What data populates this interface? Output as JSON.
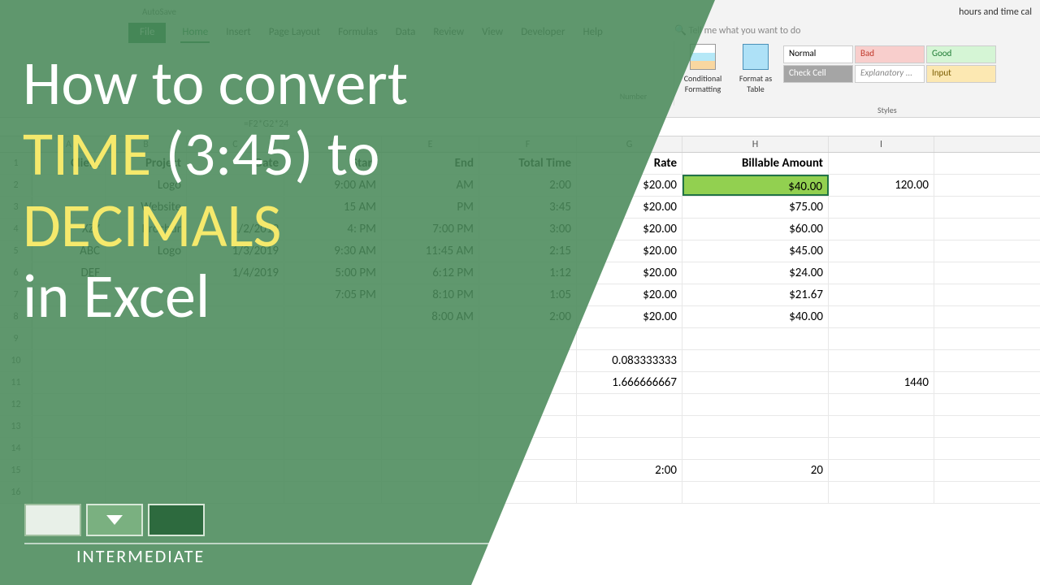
{
  "title": {
    "l1": "How to convert",
    "accent1": "TIME",
    "mid": " (3:45) to",
    "accent2": "DECIMALS",
    "l4": "in Excel"
  },
  "level": "INTERMEDIATE",
  "autosave": "AutoSave",
  "doc_title": "hours and time cal",
  "tellme": "Tell me what you want to do",
  "tabs": [
    "File",
    "Home",
    "Insert",
    "Page Layout",
    "Formulas",
    "Data",
    "Review",
    "View",
    "Developer",
    "Help"
  ],
  "ribbon": {
    "number": "Number",
    "cond": "Conditional Formatting",
    "fmt": "Format as Table",
    "styles_label": "Styles",
    "styles": [
      "Normal",
      "Bad",
      "Good",
      "Check Cell",
      "Explanatory ...",
      "Input"
    ]
  },
  "formula": "=F2*G2*24",
  "cols": [
    "A",
    "B",
    "C",
    "D",
    "E",
    "F",
    "G",
    "H",
    "I"
  ],
  "col_widths": [
    "cA",
    "cB",
    "cC",
    "cD",
    "cE",
    "cF",
    "cG",
    "cH",
    "cI"
  ],
  "headers": {
    "A": "Client",
    "B": "Project",
    "C": "Date",
    "D": "Start",
    "E": "End",
    "F": "Total Time",
    "G": "Rate",
    "H": "Billable Amount",
    "I": ""
  },
  "rows": [
    {
      "n": "2",
      "A": "",
      "B": "Logo",
      "C": "",
      "D": "9:00 AM",
      "E": "AM",
      "F": "2:00",
      "G": "$20.00",
      "H": "$40.00",
      "I": "120.00",
      "sel": "H"
    },
    {
      "n": "3",
      "A": "",
      "B": "Website",
      "C": "",
      "D": "15 AM",
      "E": "PM",
      "F": "3:45",
      "G": "$20.00",
      "H": "$75.00",
      "I": ""
    },
    {
      "n": "4",
      "A": "XZY",
      "B": "Brochur",
      "C": "1/2/2019",
      "D": "4:   PM",
      "E": "7:00 PM",
      "F": "3:00",
      "G": "$20.00",
      "H": "$60.00",
      "I": ""
    },
    {
      "n": "5",
      "A": "ABC",
      "B": "Logo",
      "C": "1/3/2019",
      "D": "9:30 AM",
      "E": "11:45 AM",
      "F": "2:15",
      "G": "$20.00",
      "H": "$45.00",
      "I": ""
    },
    {
      "n": "6",
      "A": "DEF",
      "B": "",
      "C": "1/4/2019",
      "D": "5:00 PM",
      "E": "6:12 PM",
      "F": "1:12",
      "G": "$20.00",
      "H": "$24.00",
      "I": ""
    },
    {
      "n": "7",
      "A": "",
      "B": "",
      "C": "",
      "D": "7:05 PM",
      "E": "8:10 PM",
      "F": "1:05",
      "G": "$20.00",
      "H": "$21.67",
      "I": ""
    },
    {
      "n": "8",
      "A": "",
      "B": "",
      "C": "",
      "D": "",
      "E": "8:00 AM",
      "F": "2:00",
      "G": "$20.00",
      "H": "$40.00",
      "I": ""
    },
    {
      "n": "9"
    },
    {
      "n": "10",
      "G": "0.083333333"
    },
    {
      "n": "11",
      "G": "1.666666667",
      "I": "1440"
    },
    {
      "n": "12"
    },
    {
      "n": "13"
    },
    {
      "n": "14"
    },
    {
      "n": "15",
      "G": "2:00",
      "H": "20"
    },
    {
      "n": "16"
    }
  ]
}
